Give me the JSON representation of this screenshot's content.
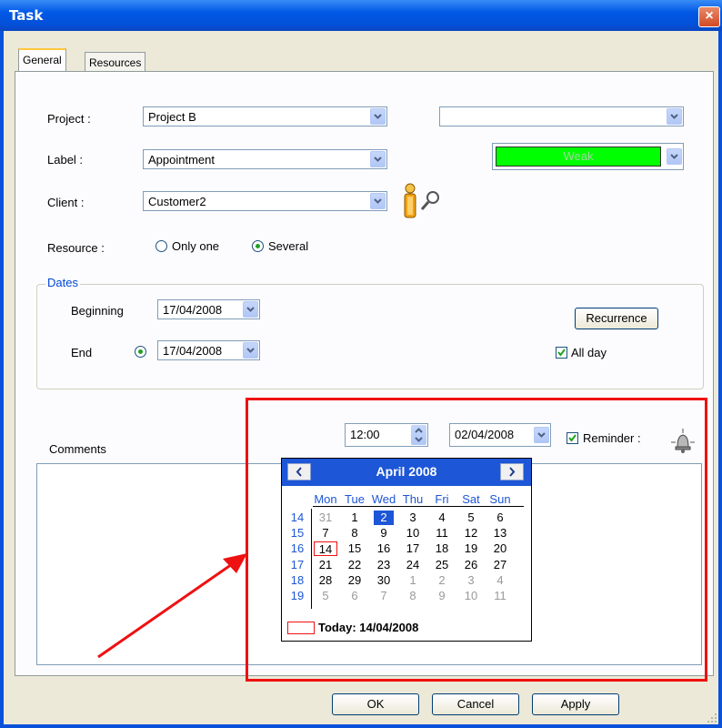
{
  "window": {
    "title": "Task",
    "close_label": "×"
  },
  "tabs": [
    {
      "label": "General"
    },
    {
      "label": "Resources"
    }
  ],
  "form": {
    "project_label": "Project :",
    "project_value": "Project B",
    "project2_value": "",
    "label_label": "Label :",
    "label_value": "Appointment",
    "priority_value": "Weak",
    "client_label": "Client :",
    "client_value": "Customer2",
    "resource_label": "Resource :",
    "resource_options": [
      {
        "label": "Only one",
        "checked": false
      },
      {
        "label": "Several",
        "checked": true
      }
    ]
  },
  "dates": {
    "group_label": "Dates",
    "beginning_label": "Beginning",
    "beginning_value": "17/04/2008",
    "end_label": "End",
    "end_value": "17/04/2008",
    "recurrence_label": "Recurrence",
    "allday_label": "All day",
    "allday_checked": true
  },
  "reminder": {
    "time_value": "12:00",
    "date_value": "02/04/2008",
    "reminder_label": "Reminder :",
    "reminder_checked": true
  },
  "comments": {
    "label": "Comments",
    "value": ""
  },
  "calendar": {
    "month_label": "April 2008",
    "prev_label": "<",
    "next_label": ">",
    "days_of_week": [
      "Mon",
      "Tue",
      "Wed",
      "Thu",
      "Fri",
      "Sat",
      "Sun"
    ],
    "weeks": [
      {
        "num": "14",
        "days": [
          "31",
          "1",
          "2",
          "3",
          "4",
          "5",
          "6"
        ]
      },
      {
        "num": "15",
        "days": [
          "7",
          "8",
          "9",
          "10",
          "11",
          "12",
          "13"
        ]
      },
      {
        "num": "16",
        "days": [
          "14",
          "15",
          "16",
          "17",
          "18",
          "19",
          "20"
        ]
      },
      {
        "num": "17",
        "days": [
          "21",
          "22",
          "23",
          "24",
          "25",
          "26",
          "27"
        ]
      },
      {
        "num": "18",
        "days": [
          "28",
          "29",
          "30",
          "1",
          "2",
          "3",
          "4"
        ]
      },
      {
        "num": "19",
        "days": [
          "5",
          "6",
          "7",
          "8",
          "9",
          "10",
          "11"
        ]
      }
    ],
    "selected_day": "2",
    "today_day": "14",
    "today_label": "Today: 14/04/2008"
  },
  "buttons": {
    "ok": "OK",
    "cancel": "Cancel",
    "apply": "Apply"
  },
  "colors": {
    "accent": "#1d56d6",
    "priority": "#00ff00",
    "highlight_box": "#ee1111",
    "arrow": "#ee1111"
  }
}
